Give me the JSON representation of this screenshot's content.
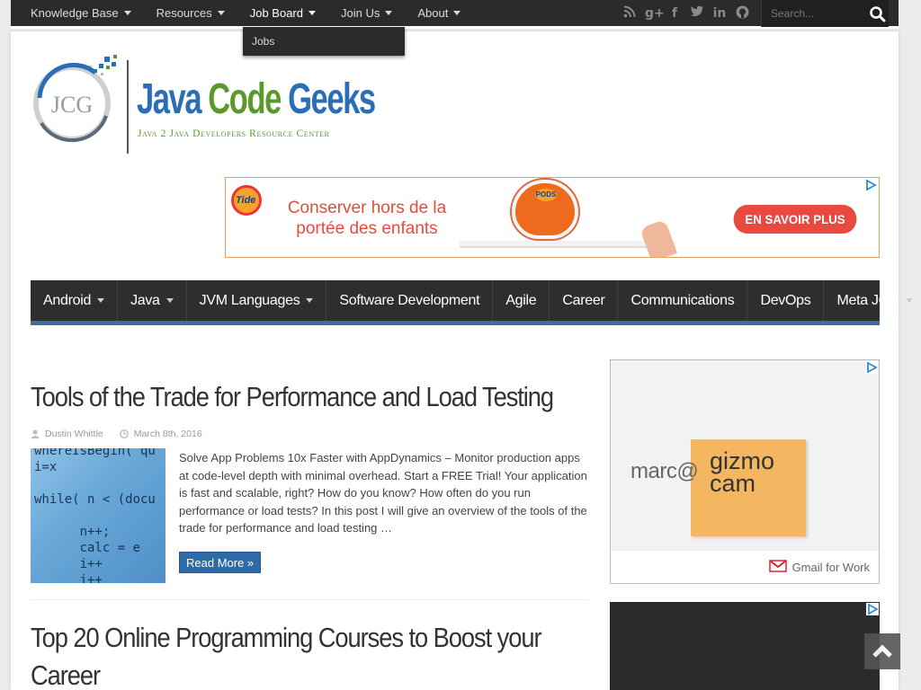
{
  "topnav": {
    "items": [
      {
        "label": "Knowledge Base",
        "has_caret": true
      },
      {
        "label": "Resources",
        "has_caret": true
      },
      {
        "label": "Job Board",
        "has_caret": true
      },
      {
        "label": "Join Us",
        "has_caret": true
      },
      {
        "label": "About",
        "has_caret": true
      }
    ],
    "dropdown": {
      "items": [
        "Jobs"
      ]
    },
    "social": [
      "rss-icon",
      "google-plus-icon",
      "facebook-icon",
      "twitter-icon",
      "linkedin-icon",
      "github-icon"
    ],
    "search": {
      "placeholder": "Search..."
    }
  },
  "logo": {
    "badge": "JCG",
    "title_part1": "Java",
    "title_part2": "Code",
    "title_part3": "Geeks",
    "tagline": "Java 2 Java Developers Resource Center"
  },
  "ad_top": {
    "brand": "Tide",
    "message": "Conserver hors de la portée des enfants",
    "product": "PODS",
    "cta": "EN SAVOIR PLUS"
  },
  "mainnav": {
    "items": [
      {
        "label": "Android",
        "has_caret": true
      },
      {
        "label": "Java",
        "has_caret": true
      },
      {
        "label": "JVM Languages",
        "has_caret": true
      },
      {
        "label": "Software Development",
        "has_caret": false
      },
      {
        "label": "Agile",
        "has_caret": false
      },
      {
        "label": "Career",
        "has_caret": false
      },
      {
        "label": "Communications",
        "has_caret": false
      },
      {
        "label": "DevOps",
        "has_caret": false
      },
      {
        "label": "Meta JCG",
        "has_caret": true
      }
    ]
  },
  "posts": [
    {
      "title": "Tools of the Trade for Performance and Load Testing",
      "author": "Dustin Whittle",
      "date": "March 8th, 2016",
      "excerpt": "Solve App Problems 10x Faster with AppDynamics – Monitor production apps at code-level depth with minimal overhead. Start a FREE Trial! Your application is fast and scalable, right? How do you know? How often do you run performance or load tests? In this post I will give an overview of the tools of the trade for performance and load testing …",
      "read_more": "Read More »",
      "thumb_code": "whereIsBegin( qu\ni=x\n\nwhile( n < (docu\n\n      n++;\n      calc = e\n      i++\n      i++"
    },
    {
      "title_line1": "Top 20 Online Programming Courses to Boost your",
      "title_line2": "Career"
    }
  ],
  "ad_side": {
    "email": "marc@",
    "brand_line1": "gizmo",
    "brand_line2": "cam",
    "footer": "Gmail for Work"
  },
  "colors": {
    "topbar": "#2a2b2c",
    "nav_accent": "#3a6ea5",
    "read_more": "#2e6aa5",
    "logo_blue": "#2b6eb7",
    "logo_green": "#5a9a2a",
    "ad_red": "#e94a3f"
  }
}
